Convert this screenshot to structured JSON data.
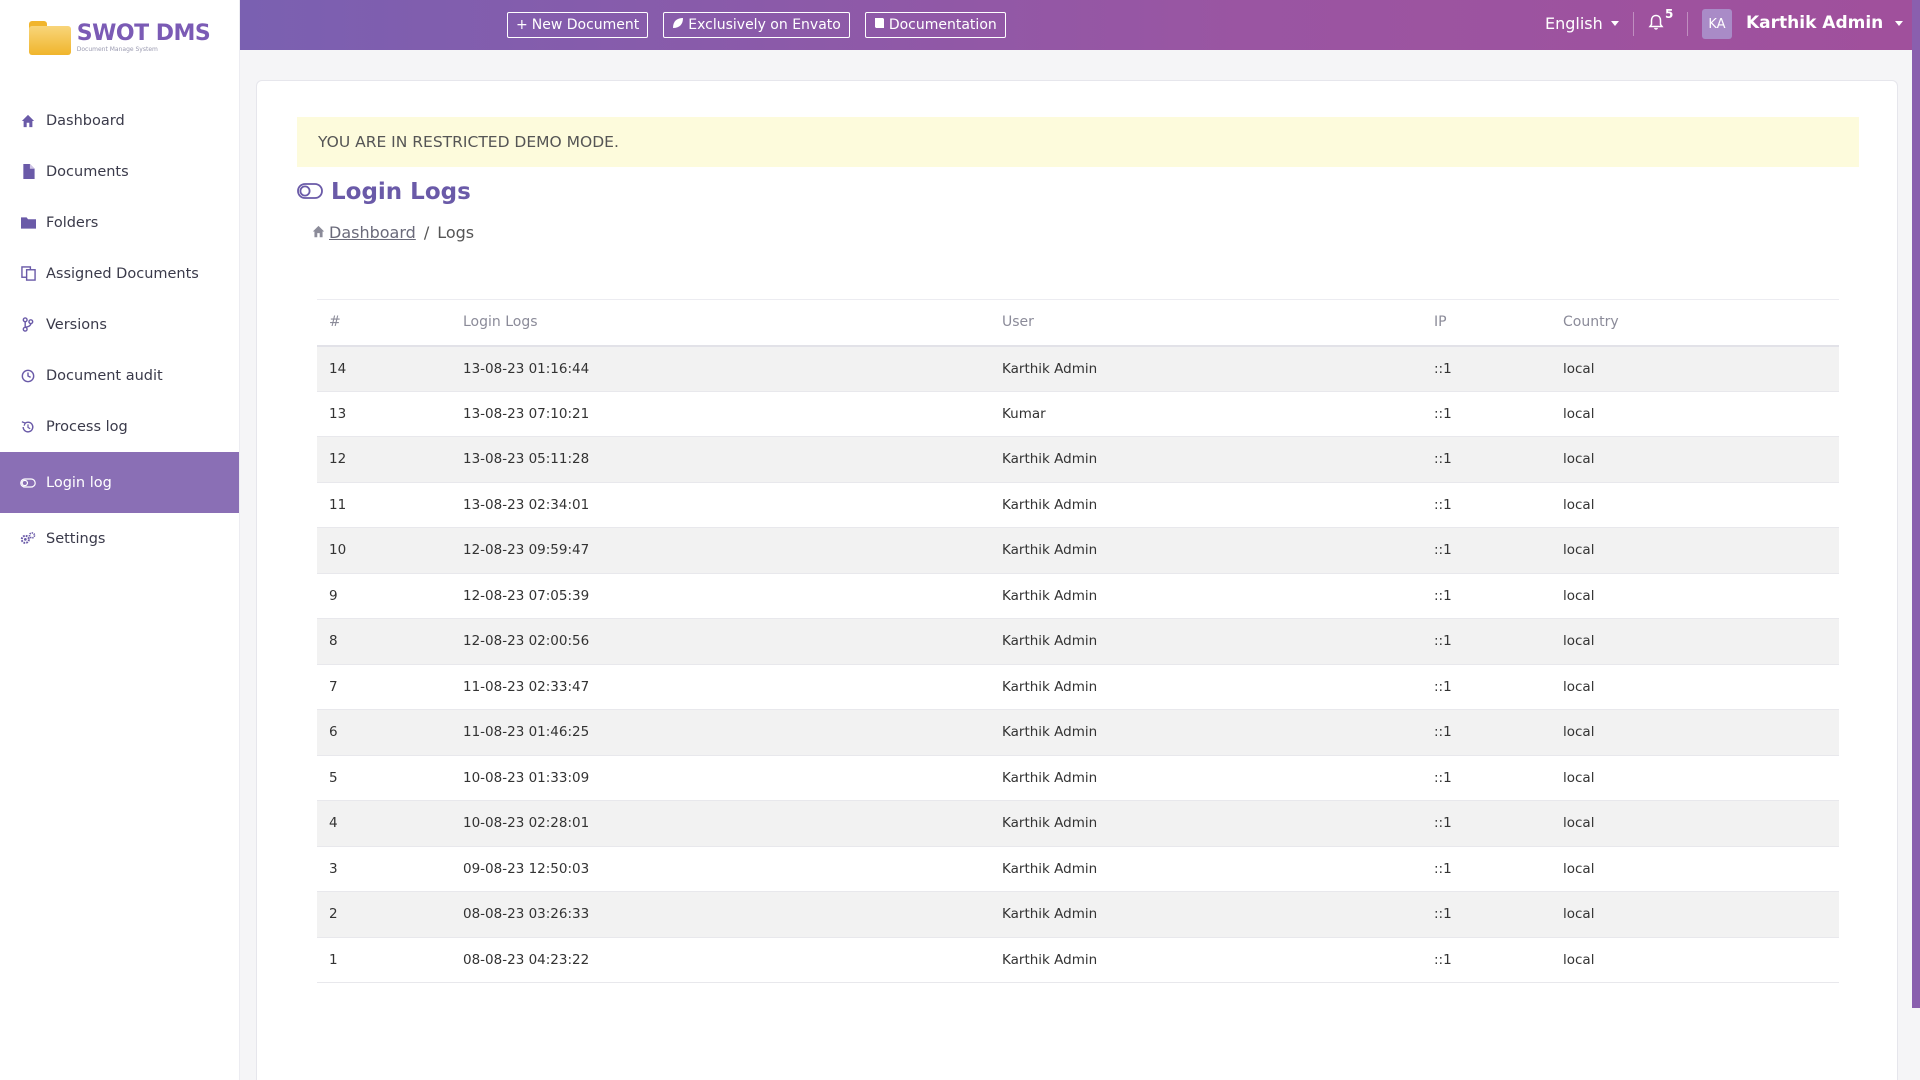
{
  "brand": {
    "name": "SWOT DMS",
    "tagline": "Document Manage System"
  },
  "sidebar": {
    "items": [
      {
        "label": "Dashboard",
        "icon": "home-icon",
        "active": false
      },
      {
        "label": "Documents",
        "icon": "file-icon",
        "active": false
      },
      {
        "label": "Folders",
        "icon": "folder-icon",
        "active": false
      },
      {
        "label": "Assigned Documents",
        "icon": "copy-icon",
        "active": false
      },
      {
        "label": "Versions",
        "icon": "branch-icon",
        "active": false
      },
      {
        "label": "Document audit",
        "icon": "clock-icon",
        "active": false
      },
      {
        "label": "Process log",
        "icon": "history-icon",
        "active": false
      },
      {
        "label": "Login log",
        "icon": "toggle-icon",
        "active": true
      },
      {
        "label": "Settings",
        "icon": "gears-icon",
        "active": false
      }
    ]
  },
  "topbar": {
    "new_document": "New Document",
    "envato": "Exclusively on Envato",
    "documentation": "Documentation",
    "language": "English",
    "notification_count": "5",
    "avatar_initials": "KA",
    "user_name": "Karthik Admin"
  },
  "alert": "YOU ARE IN RESTRICTED DEMO MODE.",
  "page": {
    "title": "Login Logs",
    "breadcrumb": {
      "home": "Dashboard",
      "current": "Logs"
    }
  },
  "table": {
    "columns": [
      "#",
      "Login Logs",
      "User",
      "IP",
      "Country"
    ],
    "rows": [
      [
        "14",
        "13-08-23 01:16:44",
        "Karthik Admin",
        "::1",
        "local"
      ],
      [
        "13",
        "13-08-23 07:10:21",
        "Kumar",
        "::1",
        "local"
      ],
      [
        "12",
        "13-08-23 05:11:28",
        "Karthik Admin",
        "::1",
        "local"
      ],
      [
        "11",
        "13-08-23 02:34:01",
        "Karthik Admin",
        "::1",
        "local"
      ],
      [
        "10",
        "12-08-23 09:59:47",
        "Karthik Admin",
        "::1",
        "local"
      ],
      [
        "9",
        "12-08-23 07:05:39",
        "Karthik Admin",
        "::1",
        "local"
      ],
      [
        "8",
        "12-08-23 02:00:56",
        "Karthik Admin",
        "::1",
        "local"
      ],
      [
        "7",
        "11-08-23 02:33:47",
        "Karthik Admin",
        "::1",
        "local"
      ],
      [
        "6",
        "11-08-23 01:46:25",
        "Karthik Admin",
        "::1",
        "local"
      ],
      [
        "5",
        "10-08-23 01:33:09",
        "Karthik Admin",
        "::1",
        "local"
      ],
      [
        "4",
        "10-08-23 02:28:01",
        "Karthik Admin",
        "::1",
        "local"
      ],
      [
        "3",
        "09-08-23 12:50:03",
        "Karthik Admin",
        "::1",
        "local"
      ],
      [
        "2",
        "08-08-23 03:26:33",
        "Karthik Admin",
        "::1",
        "local"
      ],
      [
        "1",
        "08-08-23 04:23:22",
        "Karthik Admin",
        "::1",
        "local"
      ]
    ]
  },
  "colors": {
    "accent": "#8a6fb5",
    "topbar_start": "#7a60b1",
    "topbar_end": "#a0509c",
    "alert_bg": "#fdfbdc"
  }
}
